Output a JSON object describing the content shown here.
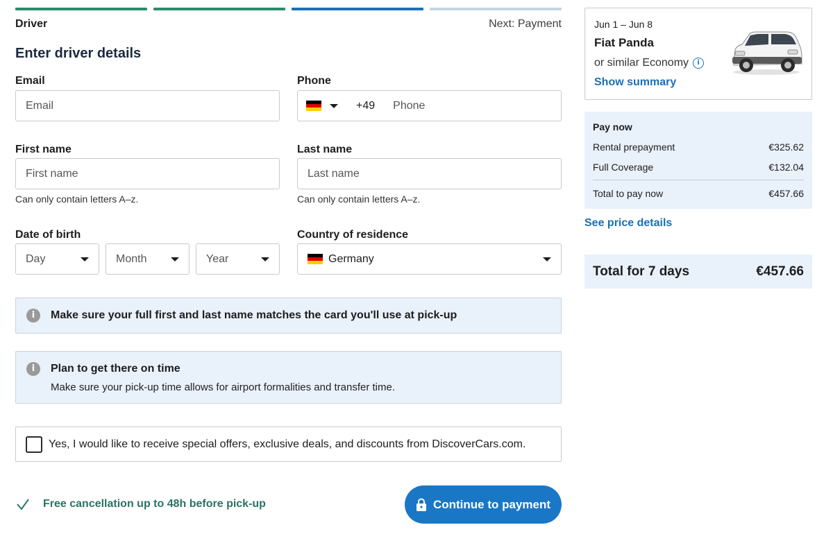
{
  "progress": {
    "colors": [
      "#2e8b6c",
      "#2e8b6c",
      "#1a6fb5",
      "#c5d4e3"
    ]
  },
  "steps": {
    "current": "Driver",
    "next": "Next: Payment"
  },
  "title": "Enter driver details",
  "form": {
    "email": {
      "label": "Email",
      "placeholder": "Email"
    },
    "phone": {
      "label": "Phone",
      "country_flag": "germany-flag",
      "code": "+49",
      "placeholder": "Phone"
    },
    "first_name": {
      "label": "First name",
      "placeholder": "First name",
      "hint": "Can only contain letters A–z."
    },
    "last_name": {
      "label": "Last name",
      "placeholder": "Last name",
      "hint": "Can only contain letters A–z."
    },
    "dob": {
      "label": "Date of birth",
      "day": "Day",
      "month": "Month",
      "year": "Year"
    },
    "country": {
      "label": "Country of residence",
      "value": "Germany"
    }
  },
  "notices": {
    "name_match": "Make sure your full first and last name matches the card you'll use at pick-up",
    "on_time_title": "Plan to get there on time",
    "on_time_body": "Make sure your pick-up time allows for airport formalities and transfer time."
  },
  "consent": {
    "label": "Yes, I would like to receive special offers, exclusive deals, and discounts from DiscoverCars.com.",
    "checked": false
  },
  "cancellation": "Free cancellation up to 48h before pick-up",
  "continue_button": "Continue to payment",
  "summary": {
    "dates": "Jun 1 – Jun 8",
    "car": "Fiat Panda",
    "similar": "or similar Economy",
    "show_summary": "Show summary"
  },
  "pay_now": {
    "header": "Pay now",
    "items": [
      {
        "label": "Rental prepayment",
        "amount": "€325.62"
      },
      {
        "label": "Full Coverage",
        "amount": "€132.04"
      }
    ],
    "total_label": "Total to pay now",
    "total_amount": "€457.66"
  },
  "price_details_link": "See price details",
  "total": {
    "label": "Total for 7 days",
    "amount": "€457.66"
  },
  "colors": {
    "accent_blue": "#1a77c6",
    "link_blue": "#1a6fb5",
    "success_green": "#2b7364",
    "info_bg": "#e9f1fb"
  }
}
